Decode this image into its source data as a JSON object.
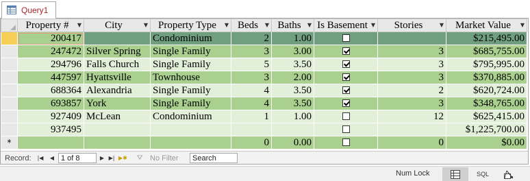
{
  "tab": {
    "label": "Query1"
  },
  "columns": [
    {
      "label": "Property #",
      "align": "num"
    },
    {
      "label": "City",
      "align": "txt"
    },
    {
      "label": "Property Type",
      "align": "txt"
    },
    {
      "label": "Beds",
      "align": "num"
    },
    {
      "label": "Baths",
      "align": "num"
    },
    {
      "label": "Is Basement",
      "align": "ctr"
    },
    {
      "label": "Stories",
      "align": "num"
    },
    {
      "label": "Market Value",
      "align": "num"
    }
  ],
  "rows": [
    {
      "property": "200417",
      "city": "",
      "type": "Condominium",
      "beds": "2",
      "baths": "1.00",
      "basement": false,
      "stories": "",
      "value": "$215,495.00"
    },
    {
      "property": "247472",
      "city": "Silver Spring",
      "type": "Single Family",
      "beds": "3",
      "baths": "3.00",
      "basement": true,
      "stories": "3",
      "value": "$685,755.00"
    },
    {
      "property": "294796",
      "city": "Falls Church",
      "type": "Single Family",
      "beds": "5",
      "baths": "3.50",
      "basement": true,
      "stories": "3",
      "value": "$795,995.00"
    },
    {
      "property": "447597",
      "city": "Hyattsville",
      "type": "Townhouse",
      "beds": "3",
      "baths": "2.00",
      "basement": true,
      "stories": "3",
      "value": "$370,885.00"
    },
    {
      "property": "688364",
      "city": "Alexandria",
      "type": "Single Family",
      "beds": "4",
      "baths": "3.50",
      "basement": true,
      "stories": "2",
      "value": "$620,724.00"
    },
    {
      "property": "693857",
      "city": "York",
      "type": "Single Family",
      "beds": "4",
      "baths": "3.50",
      "basement": true,
      "stories": "3",
      "value": "$348,765.00"
    },
    {
      "property": "927409",
      "city": "McLean",
      "type": "Condominium",
      "beds": "1",
      "baths": "1.00",
      "basement": false,
      "stories": "12",
      "value": "$625,415.00"
    },
    {
      "property": "937495",
      "city": "",
      "type": "",
      "beds": "",
      "baths": "",
      "basement": false,
      "stories": "",
      "value": "$1,225,700.00"
    }
  ],
  "new_row": {
    "marker": "*",
    "beds": "0",
    "baths": "0.00",
    "stories": "0",
    "value": "$0.00"
  },
  "nav": {
    "record_label": "Record:",
    "position": "1 of 8",
    "filter_label": "No Filter",
    "search_placeholder": "Search"
  },
  "status": {
    "numlock": "Num Lock",
    "sql": "SQL"
  },
  "colors": {
    "row_light": "#e2f0d9",
    "row_dark": "#a9d08e",
    "selected": "#f6cf57",
    "tab_text": "#a4262c"
  }
}
